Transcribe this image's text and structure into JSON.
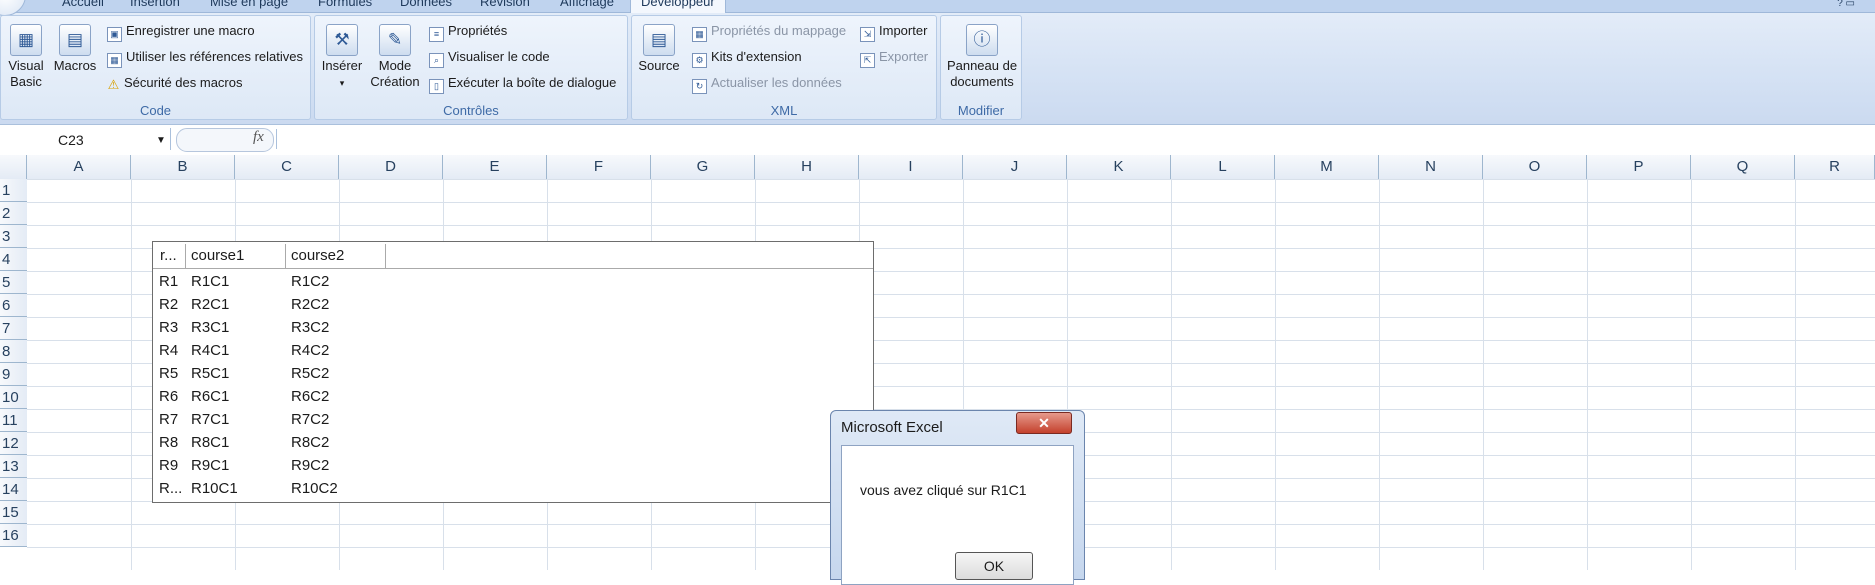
{
  "ribbon": {
    "tabs": [
      "Accueil",
      "Insertion",
      "Mise en page",
      "Formules",
      "Données",
      "Révision",
      "Affichage",
      "Développeur"
    ],
    "active_tab": "Développeur",
    "groups": {
      "code": {
        "label": "Code",
        "visual_basic": "Visual\nBasic",
        "macros": "Macros",
        "record_macro": "Enregistrer une macro",
        "relative_refs": "Utiliser les références relatives",
        "macro_security": "Sécurité des macros"
      },
      "controls": {
        "label": "Contrôles",
        "insert": "Insérer",
        "design_mode": "Mode\nCréation",
        "properties": "Propriétés",
        "view_code": "Visualiser le code",
        "run_dialog": "Exécuter la boîte de dialogue"
      },
      "xml": {
        "label": "XML",
        "source": "Source",
        "map_properties": "Propriétés du mappage",
        "expansion_packs": "Kits d'extension",
        "refresh_data": "Actualiser les données",
        "import": "Importer",
        "export": "Exporter"
      },
      "modify": {
        "label": "Modifier",
        "doc_panel": "Panneau de\ndocuments"
      }
    }
  },
  "formula_bar": {
    "name_box": "C23",
    "fx": "fx",
    "formula": ""
  },
  "grid": {
    "columns": [
      "A",
      "B",
      "C",
      "D",
      "E",
      "F",
      "G",
      "H",
      "I",
      "J",
      "K",
      "L",
      "M",
      "N",
      "O",
      "P",
      "Q",
      "R"
    ],
    "rows": [
      "1",
      "2",
      "3",
      "4",
      "5",
      "6",
      "7",
      "8",
      "9",
      "10",
      "11",
      "12",
      "13",
      "14",
      "15",
      "16"
    ]
  },
  "listview": {
    "headers": [
      "r...",
      "course1",
      "course2"
    ],
    "rows": [
      [
        "R1",
        "R1C1",
        "R1C2"
      ],
      [
        "R2",
        "R2C1",
        "R2C2"
      ],
      [
        "R3",
        "R3C1",
        "R3C2"
      ],
      [
        "R4",
        "R4C1",
        "R4C2"
      ],
      [
        "R5",
        "R5C1",
        "R5C2"
      ],
      [
        "R6",
        "R6C1",
        "R6C2"
      ],
      [
        "R7",
        "R7C1",
        "R7C2"
      ],
      [
        "R8",
        "R8C1",
        "R8C2"
      ],
      [
        "R9",
        "R9C1",
        "R9C2"
      ],
      [
        "R...",
        "R10C1",
        "R10C2"
      ]
    ]
  },
  "dialog": {
    "title": "Microsoft Excel",
    "close": "✕",
    "message": "vous avez cliqué sur  R1C1",
    "ok": "OK"
  },
  "colors": {
    "ribbon_group_label": "#3e6aa6",
    "close_button": "#c4412d",
    "grid_line": "#d8e0ea"
  }
}
